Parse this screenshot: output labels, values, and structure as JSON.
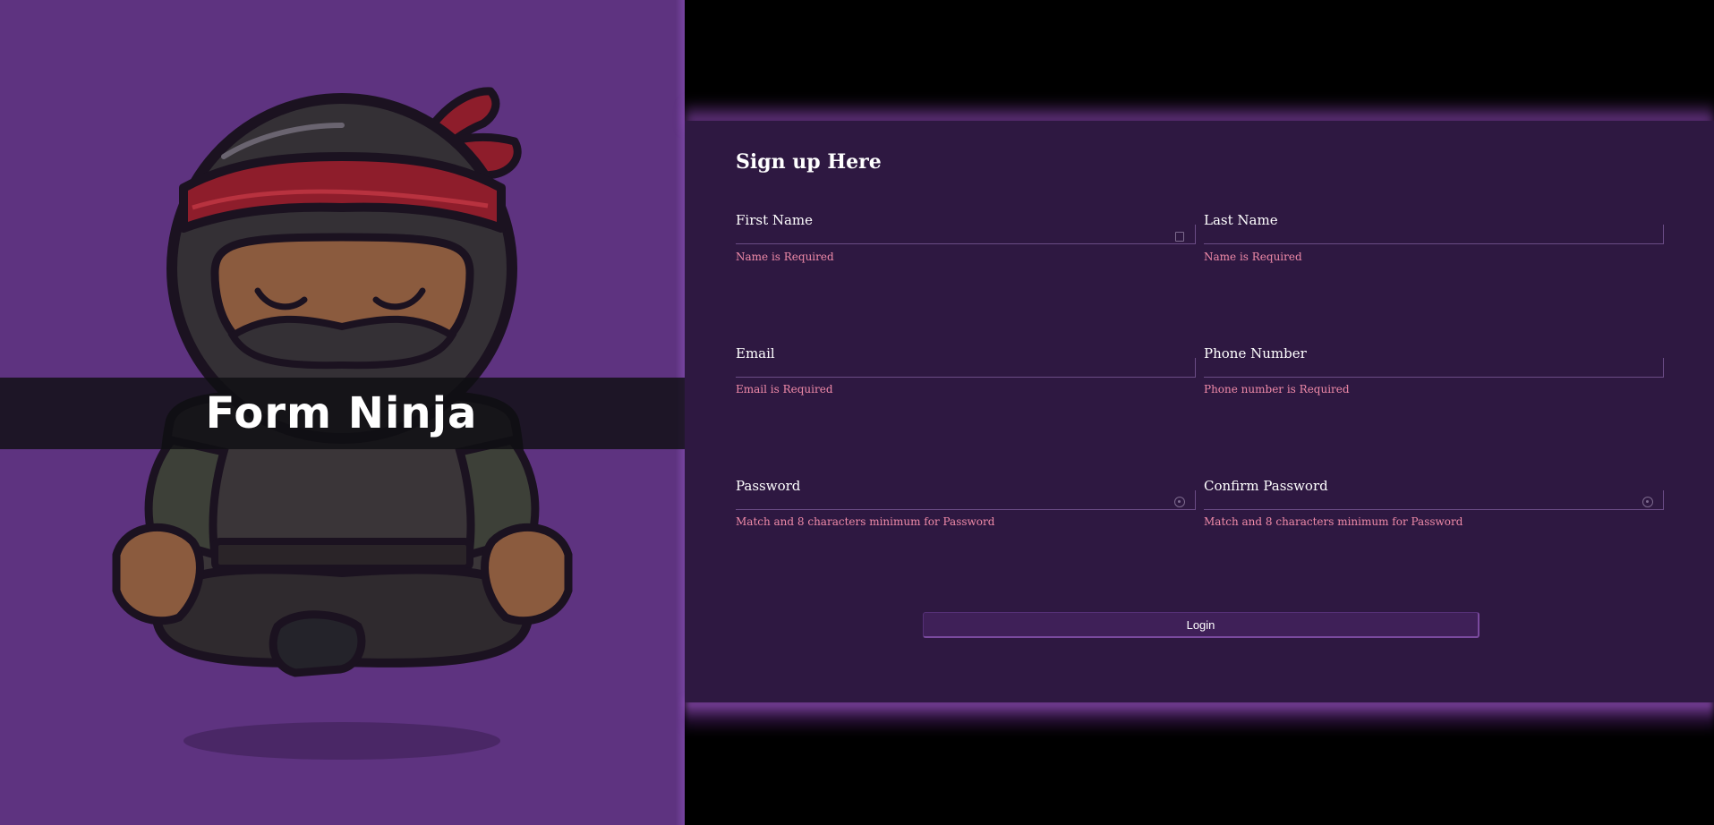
{
  "hero": {
    "brand_title": "Form Ninja",
    "illustration": "meditating-ninja-illustration",
    "background_color": "#5e3380"
  },
  "form": {
    "title": "Sign up Here",
    "fields": {
      "first_name": {
        "label": "First Name",
        "value": "",
        "error": "Name is Required",
        "icon": "id-card-icon"
      },
      "last_name": {
        "label": "Last Name",
        "value": "",
        "error": "Name is Required"
      },
      "email": {
        "label": "Email",
        "value": "",
        "error": "Email is Required"
      },
      "phone": {
        "label": "Phone Number",
        "value": "",
        "error": "Phone number is Required"
      },
      "password": {
        "label": "Password",
        "value": "",
        "error": "Match and 8 characters minimum for Password",
        "icon": "password-reveal-icon"
      },
      "confirm_password": {
        "label": "Confirm Password",
        "value": "",
        "error": "Match and 8 characters minimum for Password",
        "icon": "password-reveal-icon"
      }
    },
    "submit_label": "Login",
    "colors": {
      "panel": "#2e1841",
      "error": "#ef8aa8",
      "accent": "#7a4a9e"
    }
  }
}
